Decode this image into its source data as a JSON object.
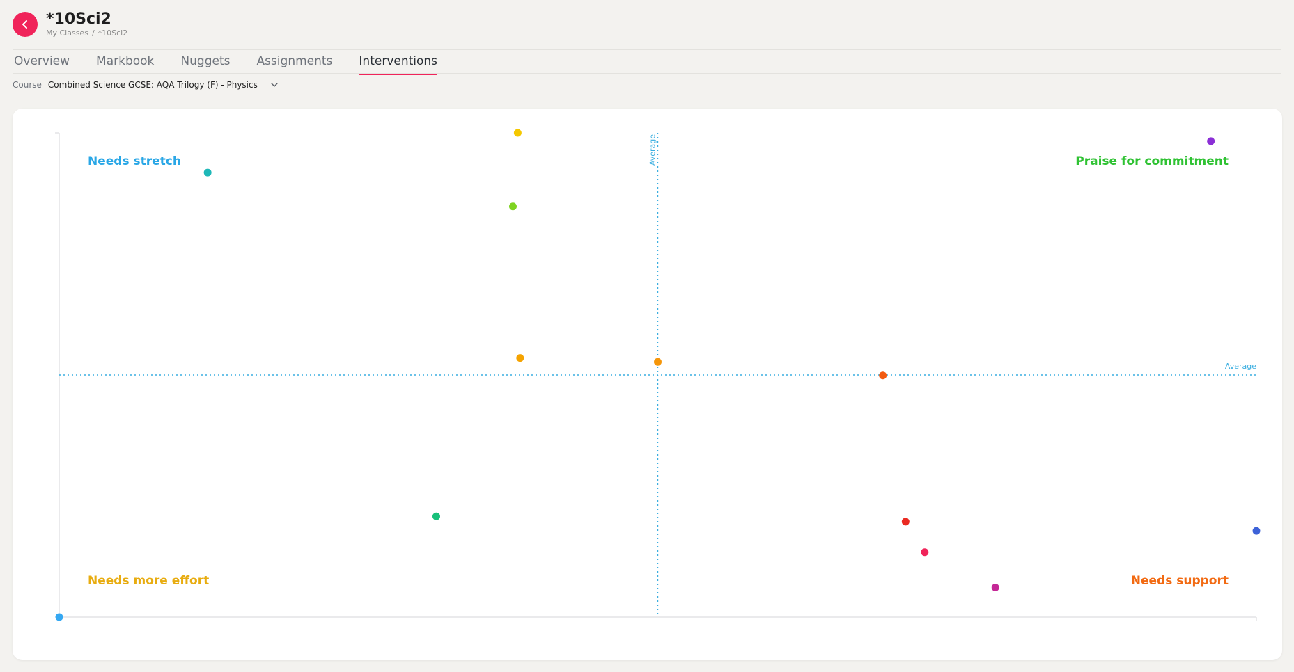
{
  "header": {
    "title": "*10Sci2",
    "breadcrumb": [
      "My Classes",
      "*10Sci2"
    ]
  },
  "tabs": [
    {
      "label": "Overview",
      "active": false
    },
    {
      "label": "Markbook",
      "active": false
    },
    {
      "label": "Nuggets",
      "active": false
    },
    {
      "label": "Assignments",
      "active": false
    },
    {
      "label": "Interventions",
      "active": true
    }
  ],
  "course": {
    "label": "Course",
    "value": "Combined Science GCSE: AQA Trilogy (F) - Physics"
  },
  "colors": {
    "accent": "#f0245a",
    "average_line": "#3aaee0",
    "needs_stretch": "#2aa7e6",
    "praise": "#2fc233",
    "needs_effort": "#e8ac10",
    "needs_support": "#f26a12"
  },
  "chart_data": {
    "type": "scatter",
    "xlim": [
      0,
      100
    ],
    "ylim": [
      0,
      100
    ],
    "average_x": 50,
    "average_y": 50,
    "average_label_x": "Average",
    "average_label_y": "Average",
    "quadrants": {
      "top_left": "Needs stretch",
      "top_right": "Praise for commitment",
      "bottom_left": "Needs more effort",
      "bottom_right": "Needs support"
    },
    "points": [
      {
        "x": 12.4,
        "y": 91.8,
        "color": "#1fb8b8"
      },
      {
        "x": 38.3,
        "y": 100,
        "color": "#f5c800"
      },
      {
        "x": 37.9,
        "y": 84.8,
        "color": "#7ed321"
      },
      {
        "x": 38.5,
        "y": 53.5,
        "color": "#f5a300"
      },
      {
        "x": 50.0,
        "y": 52.7,
        "color": "#f5960a"
      },
      {
        "x": 68.8,
        "y": 49.9,
        "color": "#f25a10"
      },
      {
        "x": 96.2,
        "y": 98.3,
        "color": "#8b2fd6"
      },
      {
        "x": 31.5,
        "y": 20.8,
        "color": "#18c07a"
      },
      {
        "x": 70.7,
        "y": 19.7,
        "color": "#ea2a22"
      },
      {
        "x": 72.3,
        "y": 13.4,
        "color": "#f0245a"
      },
      {
        "x": 78.2,
        "y": 6.1,
        "color": "#c42896"
      },
      {
        "x": 100,
        "y": 17.8,
        "color": "#3d62d8"
      },
      {
        "x": 0,
        "y": 0,
        "color": "#35a8f2"
      }
    ]
  }
}
